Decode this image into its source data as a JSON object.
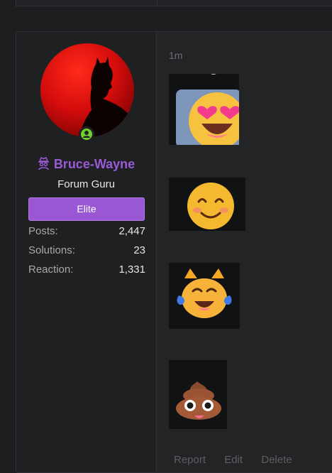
{
  "previous_post": {},
  "user": {
    "username": "Bruce-Wayne",
    "title": "Forum Guru",
    "banner": "Elite",
    "online": true,
    "stats": [
      {
        "label": "Posts:",
        "value": "2,447"
      },
      {
        "label": "Solutions:",
        "value": "23"
      },
      {
        "label": "Reaction:",
        "value": "1,331"
      }
    ]
  },
  "message": {
    "time": "1m",
    "emojis": [
      "smiling-face-with-heart-eyes",
      "smiling-face-with-smiling-eyes",
      "cat-with-tears-of-joy",
      "pile-of-poo"
    ],
    "actions": [
      "Report",
      "Edit",
      "Delete"
    ]
  },
  "colors": {
    "username": "#9a5ad6",
    "banner": "#9a57d4",
    "online": "#6fd12f",
    "background": "#1d1e20"
  }
}
